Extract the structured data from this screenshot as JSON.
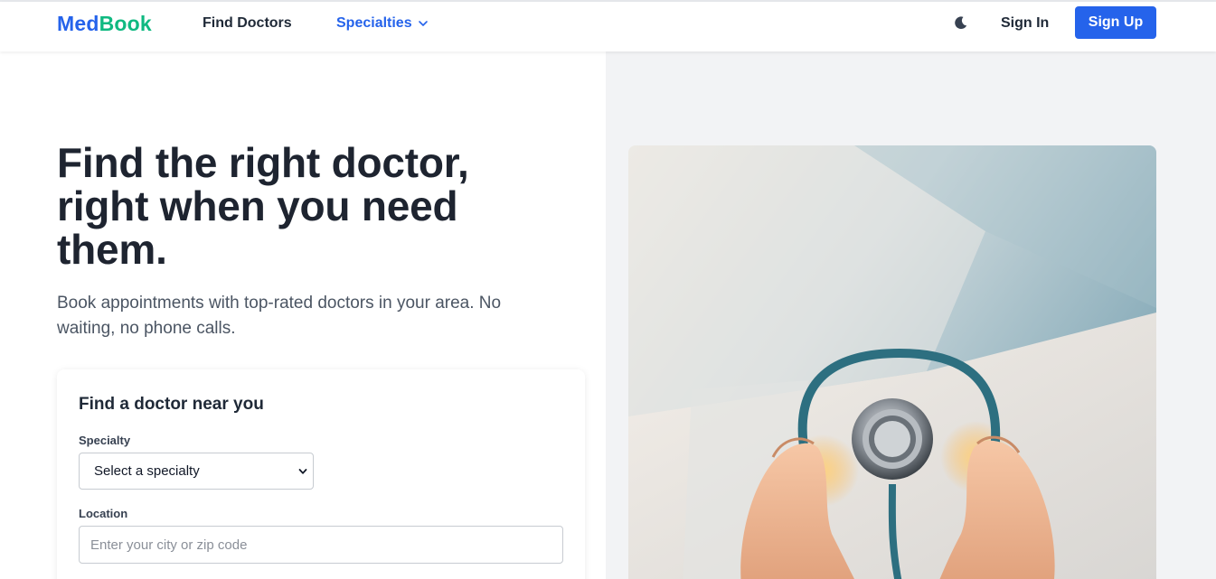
{
  "header": {
    "logo_part1": "Med",
    "logo_part2": "Book",
    "nav_find_doctors": "Find Doctors",
    "nav_specialties": "Specialties",
    "sign_in": "Sign In",
    "sign_up": "Sign Up"
  },
  "hero": {
    "title": "Find the right doctor, right when you need them.",
    "subtitle": "Book appointments with top-rated doctors in your area. No waiting, no phone calls."
  },
  "search_card": {
    "title": "Find a doctor near you",
    "specialty_label": "Specialty",
    "specialty_selected": "Select a specialty",
    "location_label": "Location",
    "location_placeholder": "Enter your city or zip code",
    "location_value": ""
  },
  "colors": {
    "brand_blue": "#2563eb",
    "brand_green": "#10b981"
  },
  "icons": {
    "theme_toggle": "moon-icon",
    "specialties_dropdown": "chevron-down-icon",
    "select_arrow": "chevron-down-icon"
  }
}
